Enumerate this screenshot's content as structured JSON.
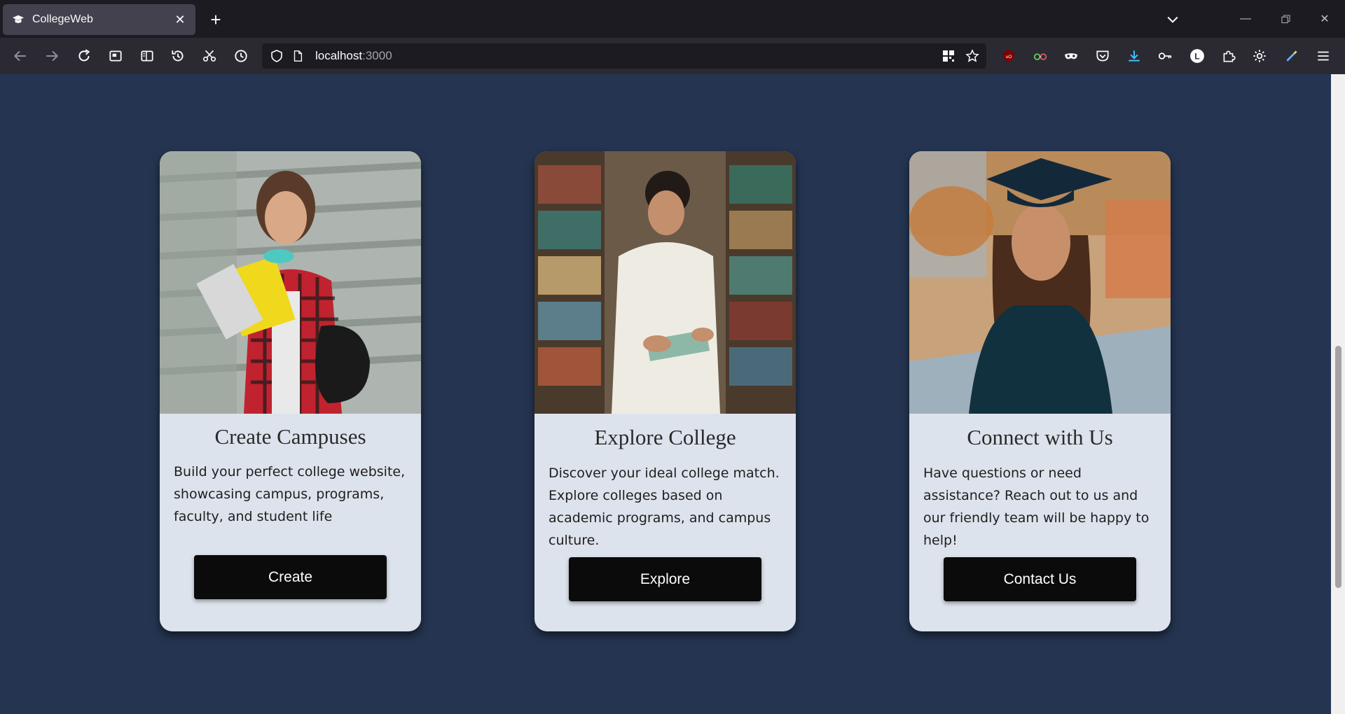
{
  "browser": {
    "tab_title": "CollegeWeb",
    "url_host": "localhost",
    "url_port": ":3000"
  },
  "cards": [
    {
      "title": "Create Campuses",
      "description": "Build your perfect college website, showcasing campus, programs, faculty, and student life",
      "button_label": "Create"
    },
    {
      "title": "Explore College",
      "description": "Discover your ideal college match. Explore colleges based on academic programs, and campus culture.",
      "button_label": "Explore"
    },
    {
      "title": "Connect with Us",
      "description": "Have questions or need assistance? Reach out to us and our friendly team will be happy to help!",
      "button_label": "Contact Us"
    }
  ],
  "colors": {
    "page_background": "#253551",
    "card_background": "#dde3ec",
    "button_background": "#0b0b0b"
  }
}
